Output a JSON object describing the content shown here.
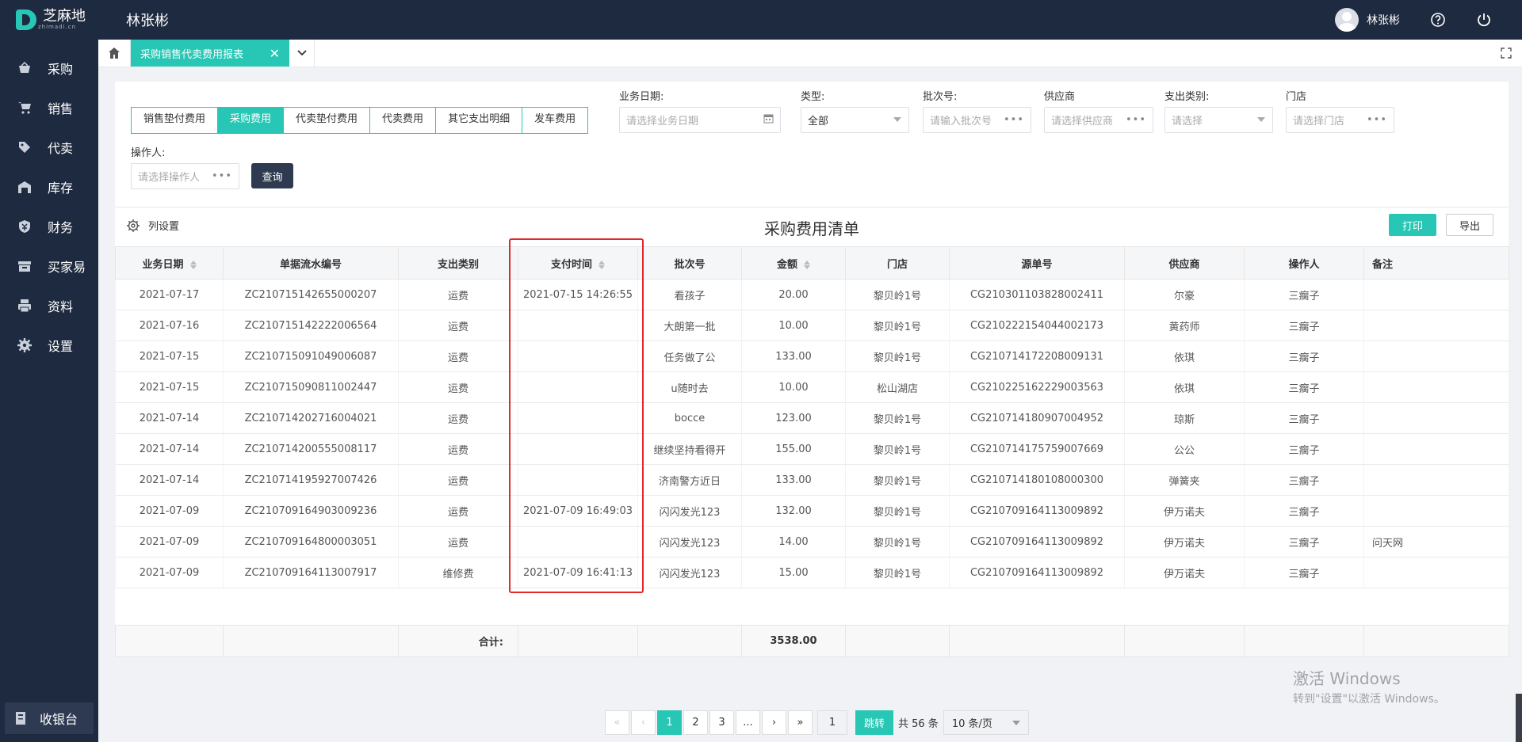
{
  "app": {
    "logo_text": "芝麻地",
    "logo_sub": "zhimadi.cn",
    "user_title": "林张彬",
    "user_name": "林张彬"
  },
  "sidebar": {
    "items": [
      {
        "label": "采购",
        "icon": "basket-icon"
      },
      {
        "label": "销售",
        "icon": "cart-icon"
      },
      {
        "label": "代卖",
        "icon": "tag-icon"
      },
      {
        "label": "库存",
        "icon": "warehouse-icon"
      },
      {
        "label": "财务",
        "icon": "finance-icon"
      },
      {
        "label": "买家易",
        "icon": "store-icon"
      },
      {
        "label": "资料",
        "icon": "printer-icon"
      },
      {
        "label": "设置",
        "icon": "gear-icon"
      }
    ],
    "cashier": "收银台"
  },
  "tabs": {
    "active": "采购销售代卖费用报表"
  },
  "filters": {
    "type_tabs": [
      "销售垫付费用",
      "采购费用",
      "代卖垫付费用",
      "代卖费用",
      "其它支出明细",
      "发车费用"
    ],
    "active_type_tab": 1,
    "date_label": "业务日期:",
    "date_placeholder": "请选择业务日期",
    "type_label": "类型:",
    "type_value": "全部",
    "batch_label": "批次号:",
    "batch_placeholder": "请输入批次号",
    "supplier_label": "供应商",
    "supplier_placeholder": "请选择供应商",
    "expense_label": "支出类别:",
    "expense_placeholder": "请选择",
    "store_label": "门店",
    "store_placeholder": "请选择门店",
    "operator_label": "操作人:",
    "operator_placeholder": "请选择操作人",
    "query_button": "查询"
  },
  "toolbar": {
    "column_settings": "列设置",
    "title": "采购费用清单",
    "print": "打印",
    "export": "导出"
  },
  "table": {
    "headers": [
      "业务日期",
      "单据流水编号",
      "支出类别",
      "支付时间",
      "批次号",
      "金额",
      "门店",
      "源单号",
      "供应商",
      "操作人",
      "备注"
    ],
    "rows": [
      [
        "2021-07-17",
        "ZC210715142655000207",
        "运费",
        "2021-07-15 14:26:55",
        "看孩子",
        "20.00",
        "黎贝岭1号",
        "CG210301103828002411",
        "尔豪",
        "三瘸子",
        ""
      ],
      [
        "2021-07-16",
        "ZC210715142222006564",
        "运费",
        "",
        "大朗第一批",
        "10.00",
        "黎贝岭1号",
        "CG210222154044002173",
        "黄药师",
        "三瘸子",
        ""
      ],
      [
        "2021-07-15",
        "ZC210715091049006087",
        "运费",
        "",
        "任务做了公",
        "133.00",
        "黎贝岭1号",
        "CG210714172208009131",
        "依琪",
        "三瘸子",
        ""
      ],
      [
        "2021-07-15",
        "ZC210715090811002447",
        "运费",
        "",
        "u随时去",
        "10.00",
        "松山湖店",
        "CG210225162229003563",
        "依琪",
        "三瘸子",
        ""
      ],
      [
        "2021-07-14",
        "ZC210714202716004021",
        "运费",
        "",
        "bocce",
        "123.00",
        "黎贝岭1号",
        "CG210714180907004952",
        "琼斯",
        "三瘸子",
        ""
      ],
      [
        "2021-07-14",
        "ZC210714200555008117",
        "运费",
        "",
        "继续坚持看得开",
        "155.00",
        "黎贝岭1号",
        "CG210714175759007669",
        "公公",
        "三瘸子",
        ""
      ],
      [
        "2021-07-14",
        "ZC210714195927007426",
        "运费",
        "",
        "济南警方近日",
        "133.00",
        "黎贝岭1号",
        "CG210714180108000300",
        "弹簧夹",
        "三瘸子",
        ""
      ],
      [
        "2021-07-09",
        "ZC210709164903009236",
        "运费",
        "2021-07-09 16:49:03",
        "闪闪发光123",
        "132.00",
        "黎贝岭1号",
        "CG210709164113009892",
        "伊万诺夫",
        "三瘸子",
        ""
      ],
      [
        "2021-07-09",
        "ZC210709164800003051",
        "运费",
        "",
        "闪闪发光123",
        "14.00",
        "黎贝岭1号",
        "CG210709164113009892",
        "伊万诺夫",
        "三瘸子",
        "问天网"
      ],
      [
        "2021-07-09",
        "ZC210709164113007917",
        "维修费",
        "2021-07-09 16:41:13",
        "闪闪发光123",
        "15.00",
        "黎贝岭1号",
        "CG210709164113009892",
        "伊万诺夫",
        "三瘸子",
        ""
      ]
    ],
    "total_label": "合计:",
    "total_amount": "3538.00"
  },
  "pagination": {
    "pages": [
      "1",
      "2",
      "3",
      "..."
    ],
    "current_input": "1",
    "jump": "跳转",
    "total": "共 56 条",
    "page_size": "10 条/页"
  },
  "watermark": {
    "line1": "激活 Windows",
    "line2": "转到\"设置\"以激活 Windows。"
  },
  "colors": {
    "accent": "#28c7b5",
    "sidebar_bg": "#1e2a3f",
    "highlight": "#e0282a"
  }
}
